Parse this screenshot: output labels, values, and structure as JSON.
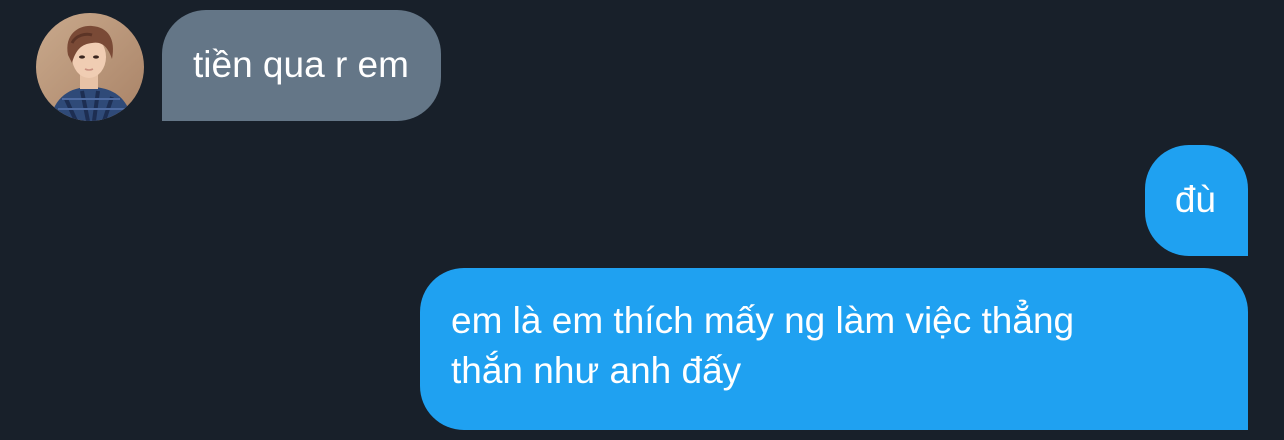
{
  "conversation": {
    "incoming": {
      "avatar_icon": "user-avatar-photo",
      "text": "tiền qua r em",
      "bubble_color": "#647687"
    },
    "outgoing": [
      {
        "text": "đù"
      },
      {
        "line1": "em là em thích mấy ng làm việc thẳng",
        "line2": "thắn như anh đấy"
      }
    ],
    "outgoing_color": "#1fa1f1",
    "background_color": "#18202a"
  }
}
